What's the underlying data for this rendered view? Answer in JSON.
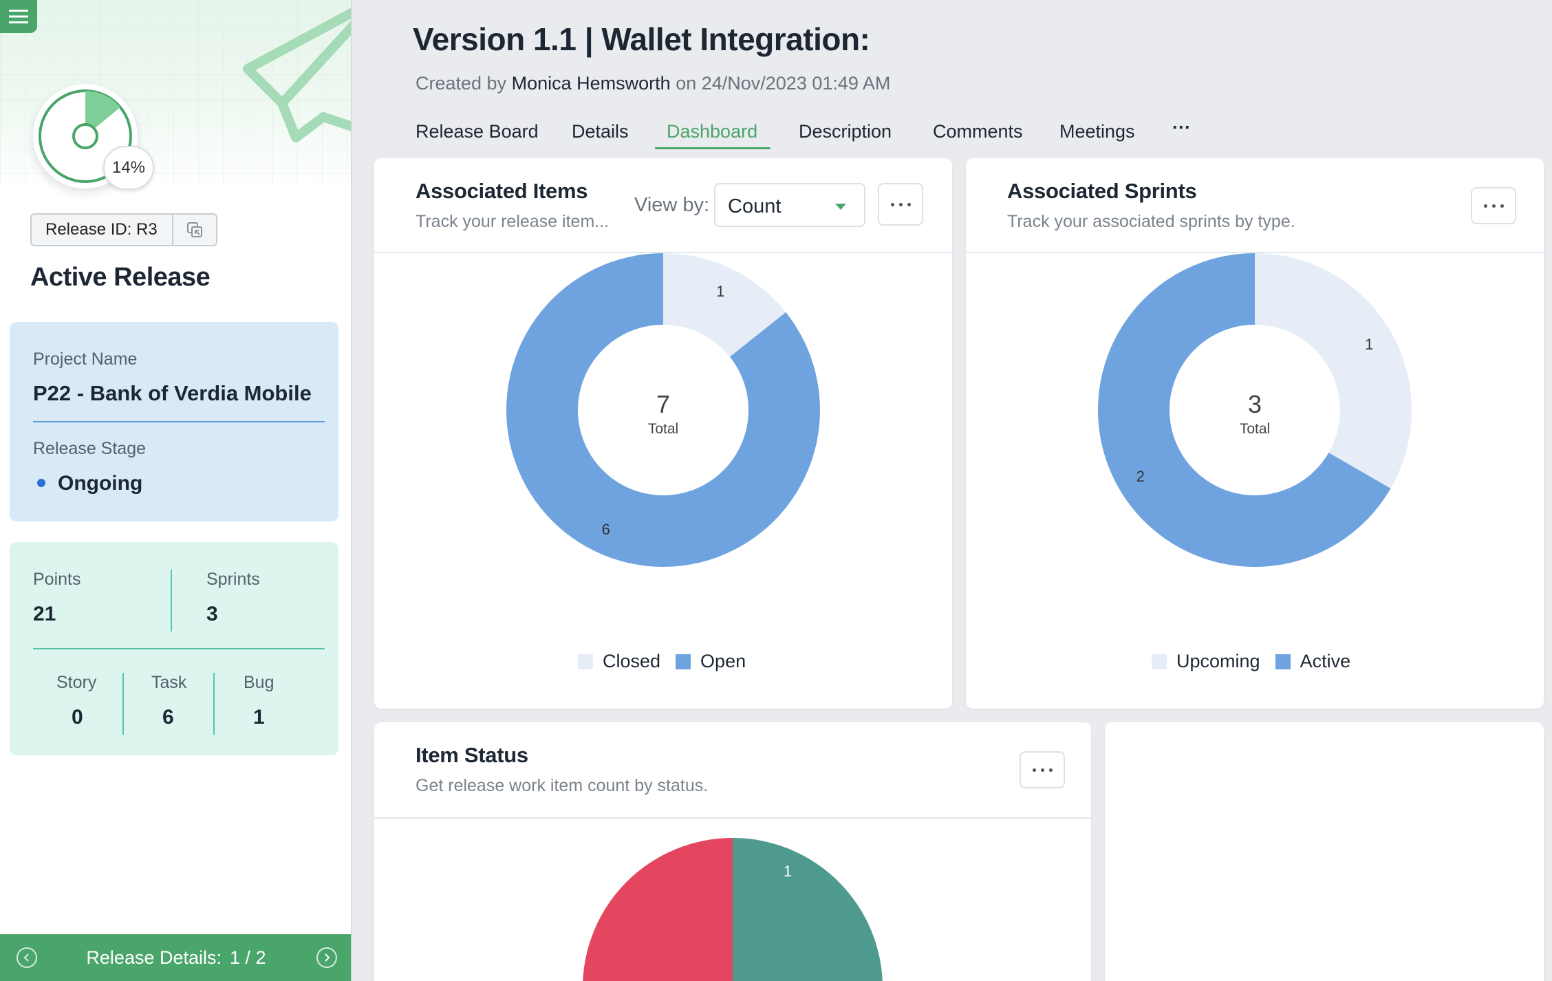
{
  "sidebar": {
    "progress_percent_label": "14%",
    "progress_fraction": 0.14,
    "release_id_label": "Release ID: R3",
    "title": "Active Release",
    "project": {
      "name_label": "Project Name",
      "name_value": "P22 - Bank of Verdia Mobile",
      "stage_label": "Release Stage",
      "stage_value": "Ongoing"
    },
    "stats": {
      "points_label": "Points",
      "points_value": "21",
      "sprints_label": "Sprints",
      "sprints_value": "3",
      "story_label": "Story",
      "story_value": "0",
      "task_label": "Task",
      "task_value": "6",
      "bug_label": "Bug",
      "bug_value": "1"
    },
    "footer": {
      "label": "Release Details:",
      "pager": "1 / 2"
    }
  },
  "header": {
    "title": "Version 1.1 |  Wallet Integration:",
    "created_prefix": "Created by",
    "author": "Monica Hemsworth",
    "created_suffix": "on 24/Nov/2023 01:49 AM"
  },
  "tabs": [
    {
      "label": "Release Board"
    },
    {
      "label": "Details"
    },
    {
      "label": "Dashboard",
      "active": true
    },
    {
      "label": "Description"
    },
    {
      "label": "Comments"
    },
    {
      "label": "Meetings"
    },
    {
      "label": "···"
    }
  ],
  "cards": {
    "associated_items": {
      "title": "Associated Items",
      "subtitle": "Track your release item...",
      "view_by_label": "View by:",
      "view_by_value": "Count"
    },
    "associated_sprints": {
      "title": "Associated Sprints",
      "subtitle": "Track your associated sprints by type."
    },
    "item_status": {
      "title": "Item Status",
      "subtitle": "Get release work item count by status."
    }
  },
  "colors": {
    "accent": "#4aa56a",
    "donut_light": "#e6edf6",
    "donut_blue": "#6ea3df",
    "status_red": "#e4465f",
    "status_teal": "#4e9a8f"
  },
  "chart_data": [
    {
      "type": "pie",
      "variant": "donut",
      "categories": [
        "Closed",
        "Open"
      ],
      "values": [
        1,
        6
      ],
      "center_value": "7",
      "center_label": "Total",
      "colors": [
        "#e6edf6",
        "#6ea3df"
      ],
      "legend": "bottom"
    },
    {
      "type": "pie",
      "variant": "donut",
      "categories": [
        "Upcoming",
        "Active"
      ],
      "values": [
        1,
        2
      ],
      "center_value": "3",
      "center_label": "Total",
      "colors": [
        "#e6edf6",
        "#6ea3df"
      ],
      "legend": "bottom"
    },
    {
      "type": "pie",
      "values": [
        1
      ],
      "value_labels": [
        "1"
      ],
      "colors": [
        "#4e9a8f",
        "#e4465f"
      ],
      "partially_visible": true
    }
  ]
}
